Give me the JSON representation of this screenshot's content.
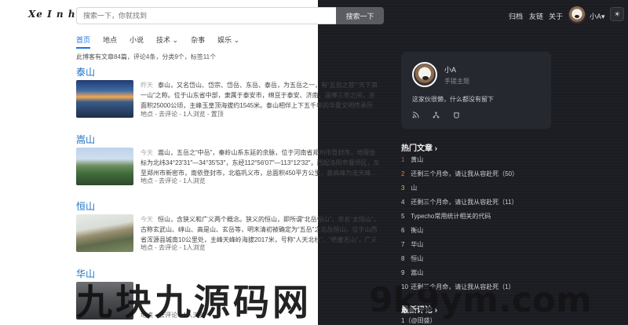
{
  "header": {
    "logo": "Xe I n h",
    "search_placeholder": "搜索一下，你就找到",
    "search_button": "搜索一下",
    "nav": [
      "归档",
      "友链",
      "关于"
    ],
    "user_name": "小A",
    "user_caret": "▾",
    "theme_icon": "☀"
  },
  "tabs": [
    "首页",
    "地点",
    "小说",
    "技术 ⌄",
    "杂事",
    "娱乐 ⌄"
  ],
  "stats": "此博客有文章84篇，评论4条，分类9个，标签11个",
  "posts": [
    {
      "title": "泰山",
      "day": "昨天",
      "excerpt": "泰山，又名岱山、岱宗、岱岳、东岳、泰岳，为五岳之一，有“五岳之首”“天下第一山”之称。位于山东省中部，隶属于泰安市，绵亘于泰安、济南、淄博三市之间，总面积25000公顷，主峰玉皇顶海拔约1545米。泰山相伴上下五千年的华夏文明传承历史，集国家兴盛…",
      "meta": "地点 - 去评论 - 1人浏览 - 置顶"
    },
    {
      "title": "嵩山",
      "day": "今天",
      "excerpt": "嵩山，五岳之“中岳”，秦岭山系东延的余脉，位于河南省郑州市登封市，地理坐标为北纬34°23′31″—34°35′53″，东经112°56′07″—113°12′32″，西起洛阳市偃师区，东至郑州市新密市，南依登封市，北临巩义市，总面积450平方公里，最高峰为连天峰…",
      "meta": "地点 - 去评论 - 1人浏览"
    },
    {
      "title": "恒山",
      "day": "今天",
      "excerpt": "恒山，含狭义和广义两个概念。狭义的恒山，即所谓“北岳恒山”，亦名“太恒山”，古称玄武山、崞山、高是山、玄岳等，明末清初被确定为“五岳”之北岳恒山，位于山西省浑源县城南10公里处，主峰天峰岭海拔2017米，号称“人天北柱”、“绝塞名山”，广义的恒山，在…",
      "meta": "地点 - 去评论 - 1人浏览"
    },
    {
      "title": "华山",
      "day": "",
      "excerpt": "",
      "meta": "地点 - 去评论 - 1人浏览"
    }
  ],
  "profile": {
    "name": "小A",
    "subtitle": "手搓主题",
    "desc": "这家伙很懒，什么都没有留下",
    "icons": [
      "rss-icon",
      "share-icon",
      "github-icon"
    ]
  },
  "hot": {
    "title": "热门文章 ›",
    "items": [
      {
        "rank": "1",
        "label": "黄山"
      },
      {
        "rank": "2",
        "label": "还剩三个月命，请让我从容赴死（50）"
      },
      {
        "rank": "3",
        "label": "山"
      },
      {
        "rank": "4",
        "label": "还剩三个月命，请让我从容赴死（11）"
      },
      {
        "rank": "5",
        "label": "Typecho常用统计相关的代码"
      },
      {
        "rank": "6",
        "label": "衡山"
      },
      {
        "rank": "7",
        "label": "华山"
      },
      {
        "rank": "8",
        "label": "恒山"
      },
      {
        "rank": "9",
        "label": "嵩山"
      },
      {
        "rank": "10",
        "label": "还剩三个月命，请让我从容赴死（1）"
      }
    ]
  },
  "recent": {
    "title": "最新评论 ›",
    "item": "1（@田盛）"
  },
  "watermark": {
    "cn": "九块九源码网",
    "url": "9k9ym.com"
  },
  "colors": {
    "link": "#1a6fbf",
    "active_tab": "#1a73e8",
    "rank1": "#e5484d",
    "rank2": "#ff7a2f",
    "rank3": "#f2b21b"
  }
}
